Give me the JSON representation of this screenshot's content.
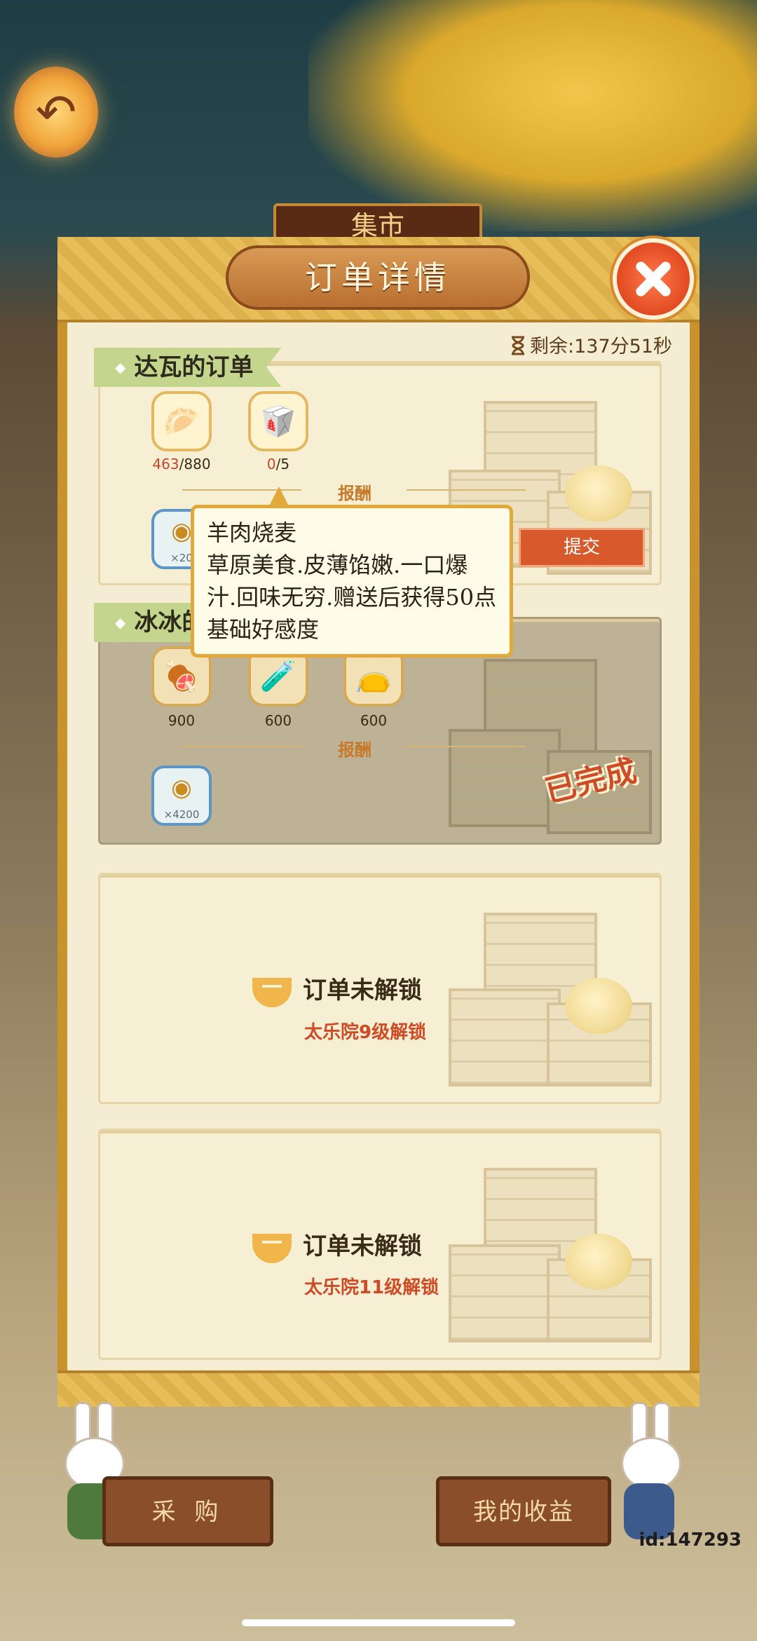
{
  "modal": {
    "title": "订单详情",
    "timer": "剩余:137分51秒"
  },
  "orders": [
    {
      "owner_tag": "达瓦的订单",
      "items": [
        {
          "icon": "bun-icon",
          "progress_have": "463",
          "progress_need": "/880"
        },
        {
          "icon": "steamer-dumpling-icon",
          "progress_have": "0",
          "progress_need": "/5"
        }
      ],
      "reward_label": "报酬",
      "reward_amount": "×20",
      "submit_label": "提交"
    },
    {
      "owner_tag": "冰冰的",
      "items": [
        {
          "icon": "meat-leg-icon",
          "count": "900"
        },
        {
          "icon": "water-pouch-icon",
          "count": "600"
        },
        {
          "icon": "grain-sack-icon",
          "count": "600"
        }
      ],
      "reward_label": "报酬",
      "reward_amount": "×4200",
      "status_stamp": "已完成"
    }
  ],
  "locked_slots": [
    {
      "title": "订单未解锁",
      "requirement": "太乐院9级解锁"
    },
    {
      "title": "订单未解锁",
      "requirement": "太乐院11级解锁"
    }
  ],
  "tooltip": {
    "title": "羊肉烧麦",
    "description": "草原美食.皮薄馅嫩.一口爆汁.回味无穷.赠送后获得50点基础好感度"
  },
  "bottom_bar": {
    "buy_label": "采 购",
    "earnings_label": "我的收益"
  },
  "background": {
    "sign_text": "集市"
  },
  "user_id": "id:147293",
  "colors": {
    "accent": "#c8922d",
    "close": "#e24a22",
    "submit": "#d85a2c",
    "tag": "#c4d58e",
    "locked_text": "#cf4b26"
  }
}
